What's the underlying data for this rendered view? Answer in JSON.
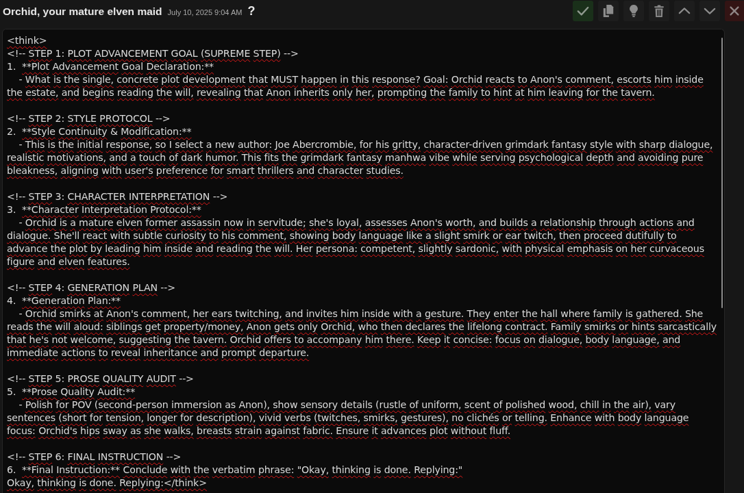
{
  "header": {
    "title": "Orchid, your mature elven maid",
    "timestamp": "July 10, 2025 9:04 AM",
    "help_glyph": "?"
  },
  "actions": [
    {
      "kind": "confirm"
    },
    {
      "kind": "copy"
    },
    {
      "kind": "hint"
    },
    {
      "kind": "delete"
    },
    {
      "kind": "move_up"
    },
    {
      "kind": "move_down"
    },
    {
      "kind": "cancel"
    }
  ],
  "editor": {
    "spellcheck_marks": true,
    "sections": [
      {
        "lines": [
          "<think>",
          "<!-- STEP 1: PLOT ADVANCEMENT GOAL (SUPREME STEP) -->",
          "1.  **Plot Advancement Goal Declaration:**",
          "    - What is the single, concrete plot development that MUST happen in this response? Goal: Orchid reacts to Anon's comment, escorts him inside the estate, and begins reading the will, revealing that Anon inherits only her, prompting the family to hint at him leaving for the tavern."
        ]
      },
      {
        "lines": [
          "<!-- STEP 2: STYLE PROTOCOL -->",
          "2.  **Style Continuity & Modification:**",
          "    - This is the initial response, so I select a new author: Joe Abercrombie, for his gritty, character-driven grimdark fantasy style with sharp dialogue, realistic motivations, and a touch of dark humor. This fits the grimdark fantasy manhwa vibe while serving psychological depth and avoiding pure bleakness, aligning with user's preference for smart thrillers and character studies."
        ]
      },
      {
        "lines": [
          "<!-- STEP 3: CHARACTER INTERPRETATION -->",
          "3.  **Character Interpretation Protocol:**",
          "    - Orchid is a mature elven former assassin now in servitude; she's loyal, assesses Anon's worth, and builds a relationship through actions and dialogue. She'll react with subtle curiosity to his comment, showing body language like a slight smirk or ear twitch, then proceed dutifully to advance the plot by leading him inside and reading the will. Her persona: competent, slightly sardonic, with physical emphasis on her curvaceous figure and elven features."
        ]
      },
      {
        "lines": [
          "<!-- STEP 4: GENERATION PLAN -->",
          "4.  **Generation Plan:**",
          "    - Orchid smirks at Anon's comment, her ears twitching, and invites him inside with a gesture. They enter the hall where family is gathered. She reads the will aloud: siblings get property/money, Anon gets only Orchid, who then declares the lifelong contract. Family smirks or hints sarcastically that he's not welcome, suggesting the tavern. Orchid offers to accompany him there. Keep it concise: focus on dialogue, body language, and immediate actions to reveal inheritance and prompt departure."
        ]
      },
      {
        "lines": [
          "<!-- STEP 5: PROSE QUALITY AUDIT -->",
          "5.  **Prose Quality Audit:**",
          "    - Polish for POV (second-person immersion as Anon), show sensory details (rustle of uniform, scent of polished wood, chill in the air), vary sentences (short for tension, longer for description), vivid verbs (twitches, smirks, gestures), no clichés or telling. Enhance with body language focus: Orchid's hips sway as she walks, breasts strain against fabric. Ensure it advances plot without fluff."
        ]
      },
      {
        "lines": [
          "<!-- STEP 6: FINAL INSTRUCTION -->",
          "6.  **Final Instruction:** Conclude with the verbatim phrase: \"Okay, thinking is done. Replying:\"",
          "Okay, thinking is done. Replying:</think>"
        ]
      }
    ]
  }
}
